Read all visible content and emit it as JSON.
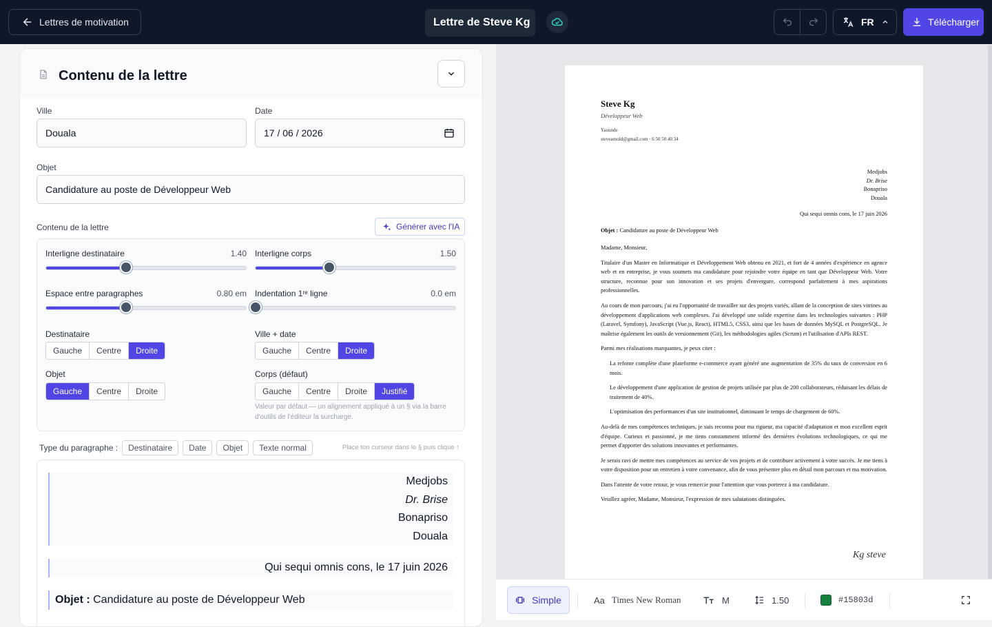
{
  "header": {
    "back_label": "Lettres de motivation",
    "doc_title": "Lettre de Steve Kg",
    "language": "FR",
    "download_label": "Télécharger"
  },
  "panel": {
    "title": "Contenu de la lettre",
    "ville_label": "Ville",
    "ville_value": "Douala",
    "date_label": "Date",
    "date_value": "17 / 06 / 2026",
    "objet_label": "Objet",
    "objet_value": "Candidature au poste de Développeur Web",
    "contenu_label": "Contenu de la lettre",
    "generate_label": "Générer avec l'IA"
  },
  "settings": {
    "interligne_dest_label": "Interligne destinataire",
    "interligne_dest_value": "1.40",
    "interligne_dest_level": 0.4,
    "interligne_corps_label": "Interligne corps",
    "interligne_corps_value": "1.50",
    "interligne_corps_level": 0.37,
    "espace_label": "Espace entre paragraphes",
    "espace_value": "0.80 em",
    "espace_level": 0.4,
    "indent_label": "Indentation 1ʳᵉ ligne",
    "indent_value": "0.0 em",
    "indent_level": 0.0,
    "destinataire_label": "Destinataire",
    "ville_date_label": "Ville + date",
    "objet_align_label": "Objet",
    "corps_label": "Corps (défaut)",
    "opt_gauche": "Gauche",
    "opt_centre": "Centre",
    "opt_droite": "Droite",
    "opt_justifie": "Justifié",
    "hint": "Valeur par défaut — un alignement appliqué à un § via la barre d'outils de l'éditeur la surcharge."
  },
  "types": {
    "label": "Type du paragraphe :",
    "items": [
      "Destinataire",
      "Date",
      "Objet",
      "Texte normal"
    ],
    "cursor_hint": "Place ton curseur dans le § puis clique ↑"
  },
  "editor": {
    "recipient": [
      "Medjobs",
      "Dr. Brise",
      "Bonapriso",
      "Douala"
    ],
    "date_line": "Qui sequi omnis cons, le 17 juin 2026",
    "objet_prefix": "Objet :",
    "objet_text": "Candidature au poste de Développeur Web"
  },
  "letter": {
    "name": "Steve Kg",
    "role": "Développeur Web",
    "city": "Yaounde",
    "contact": "stevearnold@gmail.com · 6 50 50 40 34",
    "recipient": [
      "Medjobs",
      "Dr. Brise",
      "Bonapriso",
      "Douala"
    ],
    "date_line": "Qui sequi omnis cons, le 17 juin 2026",
    "objet_prefix": "Objet :",
    "objet_text": "Candidature au poste de Développeur Web",
    "salutation": "Madame, Monsieur,",
    "p1": "Titulaire d'un Master en Informatique et Développement Web obtenu en 2021, et fort de 4 années d'expérience en agence web et en entreprise, je vous soumets ma candidature pour rejoindre votre équipe en tant que Développeur Web. Votre structure, reconnue pour son innovation et ses projets d'envergure, correspond parfaitement à mes aspirations professionnelles.",
    "p2": "Au cours de mon parcours, j'ai eu l'opportunité de travailler sur des projets variés, allant de la conception de sites vitrines au développement d'applications web complexes. J'ai développé une solide expertise dans les technologies suivantes : PHP (Laravel, Symfony), JavaScript (Vue.js, React), HTML5, CSS3, ainsi que les bases de données MySQL et PostgreSQL. Je maîtrise également les outils de versionnement (Git), les méthodologies agiles (Scrum) et l'utilisation d'APIs REST.",
    "p3": "Parmi mes réalisations marquantes, je peux citer :",
    "b1": "La refonte complète d'une plateforme e-commerce ayant généré une augmentation de 35% du taux de conversion en 6 mois.",
    "b2": "Le développement d'une application de gestion de projets utilisée par plus de 200 collaborateurs, réduisant les délais de traitement de 40%.",
    "b3": "L'optimisation des performances d'un site institutionnel, diminuant le temps de chargement de 60%.",
    "p4": "Au-delà de mes compétences techniques, je suis reconnu pour ma rigueur, ma capacité d'adaptation et mon excellent esprit d'équipe. Curieux et passionné, je me tiens constamment informé des dernières évolutions technologiques, ce qui me permet d'apporter des solutions innovantes et performantes.",
    "p5": "Je serais ravi de mettre mes compétences au service de vos projets et de contribuer activement à votre succès. Je me tiens à votre disposition pour un entretien à votre convenance, afin de vous présenter plus en détail mon parcours et ma motivation.",
    "p6": "Dans l'attente de votre retour, je vous remercie pour l'attention que vous porterez à ma candidature.",
    "p7": "Veuillez agréer, Madame, Monsieur, l'expression de mes salutations distinguées.",
    "signature": "Kg steve"
  },
  "bottombar": {
    "template": "Simple",
    "font_prefix": "Aa",
    "font": "Times New Roman",
    "size": "M",
    "line_height": "1.50",
    "color_hex": "#15803d",
    "color_label": "#15803d"
  }
}
